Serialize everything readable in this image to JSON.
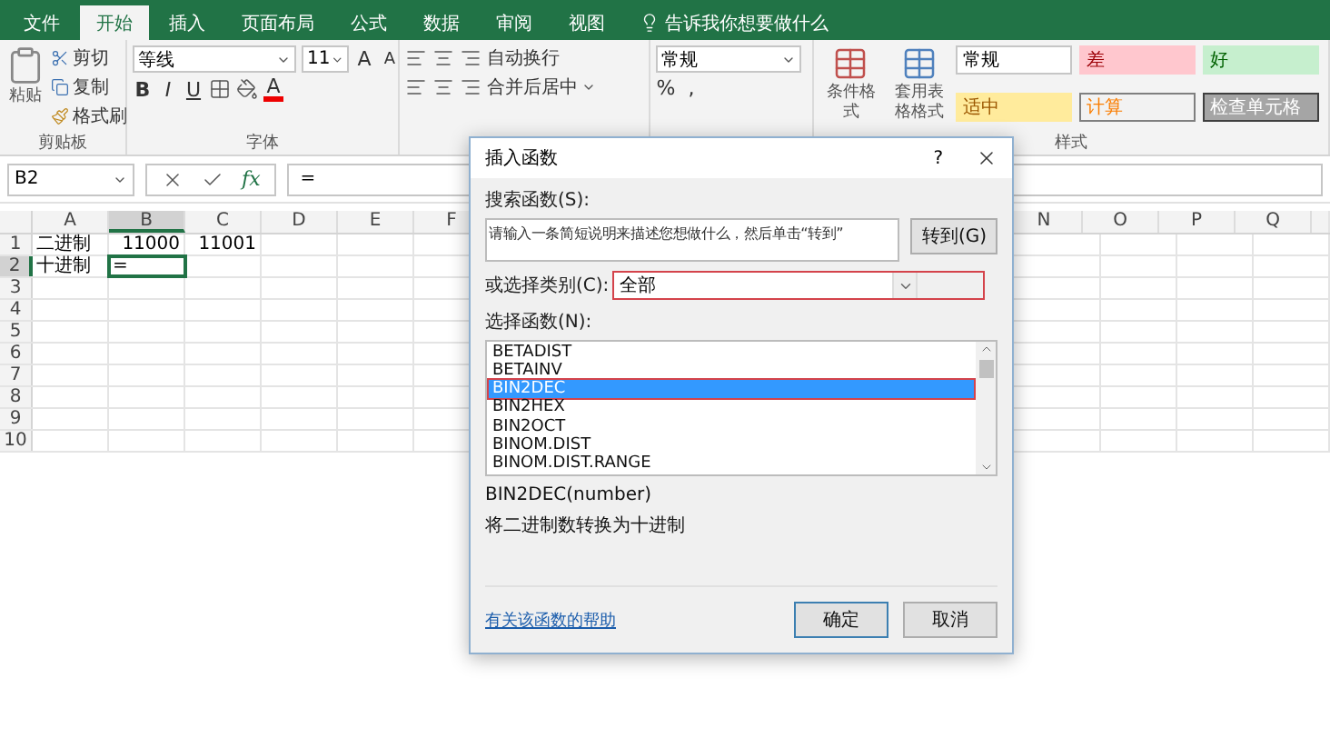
{
  "tabs": [
    {
      "label": "文件",
      "selected": false
    },
    {
      "label": "开始",
      "selected": true
    },
    {
      "label": "插入",
      "selected": false
    },
    {
      "label": "页面布局",
      "selected": false
    },
    {
      "label": "公式",
      "selected": false
    },
    {
      "label": "数据",
      "selected": false
    },
    {
      "label": "审阅",
      "selected": false
    },
    {
      "label": "视图",
      "selected": false
    }
  ],
  "tell_me": "告诉我你想要做什么",
  "ribbon": {
    "clipboard": {
      "paste": "粘贴",
      "cut": "剪切",
      "copy": "复制",
      "format_painter": "格式刷",
      "label": "剪贴板"
    },
    "font": {
      "name": "等线",
      "size": "11",
      "grow": "A",
      "shrink": "A",
      "bold": "B",
      "italic": "I",
      "underline": "U",
      "font_color": "A",
      "label": "字体"
    },
    "alignment": {
      "wrap": "自动换行",
      "merge": "合并后居中"
    },
    "number": {
      "format": "常规",
      "percent": "%",
      "comma": ","
    },
    "styles": {
      "conditional": "条件格式",
      "table": "套用表格格式",
      "label": "样式",
      "cells": [
        {
          "label": "常规",
          "kind": "normal"
        },
        {
          "label": "差",
          "kind": "bad"
        },
        {
          "label": "好",
          "kind": "good"
        },
        {
          "label": "适中",
          "kind": "neutral"
        },
        {
          "label": "计算",
          "kind": "calc"
        },
        {
          "label": "检查单元格",
          "kind": "check"
        }
      ]
    }
  },
  "formula_bar": {
    "name_box": "B2",
    "fx": "fx",
    "formula": "="
  },
  "sheet": {
    "left_columns": [
      {
        "label": "A",
        "selected": false
      },
      {
        "label": "B",
        "selected": true
      },
      {
        "label": "C",
        "selected": false
      },
      {
        "label": "D",
        "selected": false
      },
      {
        "label": "E",
        "selected": false
      },
      {
        "label": "F",
        "selected": false
      }
    ],
    "right_columns": [
      {
        "label": "N"
      },
      {
        "label": "O"
      },
      {
        "label": "P"
      },
      {
        "label": "Q"
      }
    ],
    "rows": [
      {
        "number": "1",
        "selected": false,
        "cells": [
          {
            "text": "二进制",
            "kind": "text",
            "selected": false
          },
          {
            "text": "11000",
            "kind": "number",
            "selected": false
          },
          {
            "text": "11001",
            "kind": "number",
            "selected": false
          }
        ]
      },
      {
        "number": "2",
        "selected": true,
        "cells": [
          {
            "text": "十进制",
            "kind": "text",
            "selected": false
          },
          {
            "text": "=",
            "kind": "text",
            "selected": true
          }
        ]
      },
      {
        "number": "3",
        "selected": false,
        "cells": []
      },
      {
        "number": "4",
        "selected": false,
        "cells": []
      },
      {
        "number": "5",
        "selected": false,
        "cells": []
      },
      {
        "number": "6",
        "selected": false,
        "cells": []
      },
      {
        "number": "7",
        "selected": false,
        "cells": []
      },
      {
        "number": "8",
        "selected": false,
        "cells": []
      },
      {
        "number": "9",
        "selected": false,
        "cells": []
      },
      {
        "number": "10",
        "selected": false,
        "cells": []
      }
    ]
  },
  "dialog": {
    "title": "插入函数",
    "help": "?",
    "search_label": "搜索函数(S):",
    "search_text": "请输入一条简短说明来描述您想做什么，然后单击“转到”",
    "go_button": "转到(G)",
    "category_label": "或选择类别(C):",
    "category": "全部",
    "list_label": "选择函数(N):",
    "functions": [
      {
        "name": "BETADIST",
        "selected": false
      },
      {
        "name": "BETAINV",
        "selected": false
      },
      {
        "name": "BIN2DEC",
        "selected": true
      },
      {
        "name": "BIN2HEX",
        "selected": false
      },
      {
        "name": "BIN2OCT",
        "selected": false
      },
      {
        "name": "BINOM.DIST",
        "selected": false
      },
      {
        "name": "BINOM.DIST.RANGE",
        "selected": false
      }
    ],
    "signature": "BIN2DEC(number)",
    "description": "将二进制数转换为十进制",
    "help_link": "有关该函数的帮助",
    "ok": "确定",
    "cancel": "取消"
  }
}
